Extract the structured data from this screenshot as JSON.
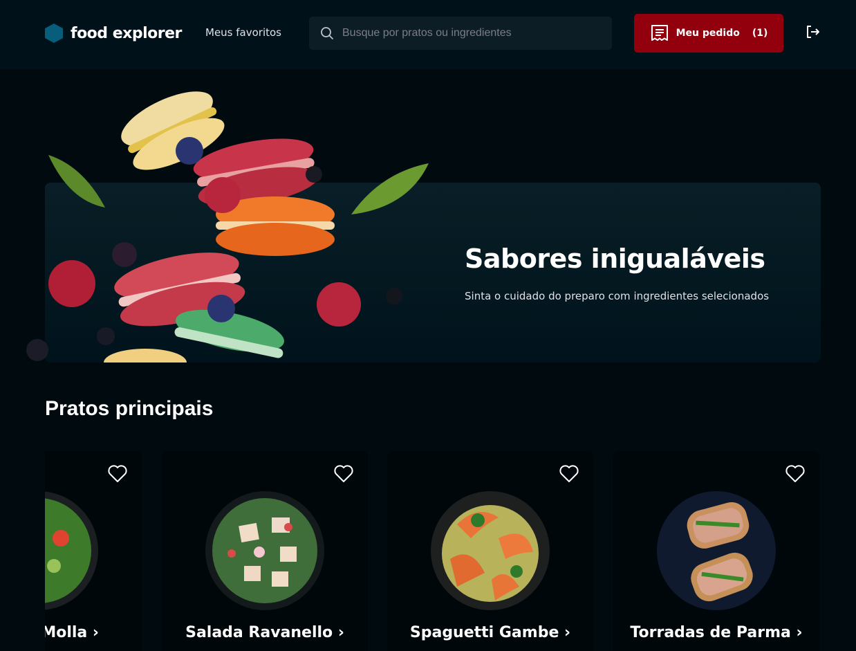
{
  "header": {
    "brand": "food explorer",
    "favorites_link": "Meus favoritos",
    "search_placeholder": "Busque por pratos ou ingredientes",
    "order_button_label": "Meu pedido",
    "order_count": "(1)",
    "colors": {
      "background": "#00111a",
      "order_button": "#92000e",
      "logo": "#065e7c"
    }
  },
  "banner": {
    "title": "Sabores inigualáveis",
    "subtitle": "Sinta o cuidado do preparo com ingredientes selecionados"
  },
  "section": {
    "title": "Pratos principais"
  },
  "dishes": [
    {
      "name": "Molla ›",
      "icon": "salad-plate"
    },
    {
      "name": "Salada Ravanello ›",
      "icon": "salad-plate"
    },
    {
      "name": "Spaguetti Gambe ›",
      "icon": "pasta-plate"
    },
    {
      "name": "Torradas de Parma ›",
      "icon": "toast-plate"
    }
  ]
}
